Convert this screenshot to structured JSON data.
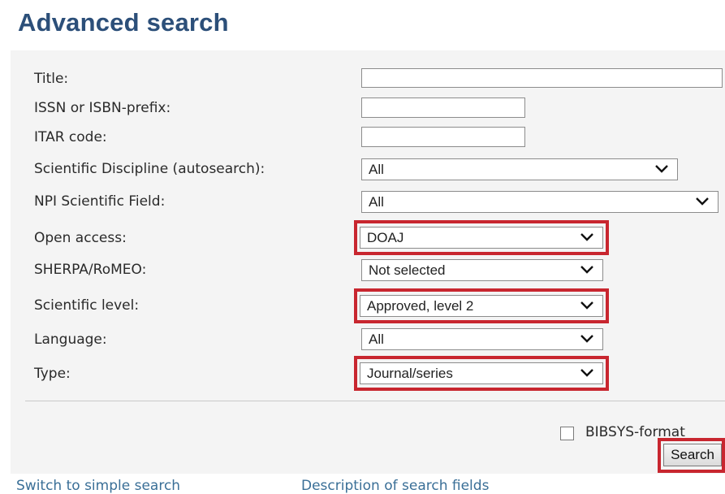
{
  "page": {
    "title": "Advanced search"
  },
  "form": {
    "title_label": "Title:",
    "issn_label": "ISSN or ISBN-prefix:",
    "itar_label": "ITAR code:",
    "discipline_label": "Scientific Discipline (autosearch):",
    "discipline_value": "All",
    "npi_label": "NPI Scientific Field:",
    "npi_value": "All",
    "open_access_label": "Open access:",
    "open_access_value": "DOAJ",
    "sherpa_label": "SHERPA/RoMEO:",
    "sherpa_value": "Not selected",
    "level_label": "Scientific level:",
    "level_value": "Approved, level 2",
    "language_label": "Language:",
    "language_value": "All",
    "type_label": "Type:",
    "type_value": "Journal/series"
  },
  "options": {
    "bibsys_label": "BIBSYS-format",
    "bibsys_checked": false,
    "search_label": "Search"
  },
  "footer": {
    "simple_search_link": "Switch to simple search",
    "description_link": "Description of search fields"
  },
  "highlight_color": "#c8262f"
}
